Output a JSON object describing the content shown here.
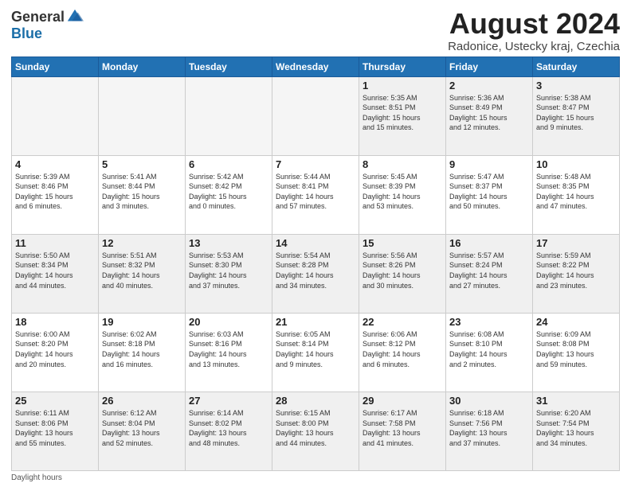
{
  "logo": {
    "general": "General",
    "blue": "Blue"
  },
  "title": "August 2024",
  "subtitle": "Radonice, Ustecky kraj, Czechia",
  "days_of_week": [
    "Sunday",
    "Monday",
    "Tuesday",
    "Wednesday",
    "Thursday",
    "Friday",
    "Saturday"
  ],
  "footer": "Daylight hours",
  "weeks": [
    [
      {
        "day": "",
        "info": ""
      },
      {
        "day": "",
        "info": ""
      },
      {
        "day": "",
        "info": ""
      },
      {
        "day": "",
        "info": ""
      },
      {
        "day": "1",
        "info": "Sunrise: 5:35 AM\nSunset: 8:51 PM\nDaylight: 15 hours\nand 15 minutes."
      },
      {
        "day": "2",
        "info": "Sunrise: 5:36 AM\nSunset: 8:49 PM\nDaylight: 15 hours\nand 12 minutes."
      },
      {
        "day": "3",
        "info": "Sunrise: 5:38 AM\nSunset: 8:47 PM\nDaylight: 15 hours\nand 9 minutes."
      }
    ],
    [
      {
        "day": "4",
        "info": "Sunrise: 5:39 AM\nSunset: 8:46 PM\nDaylight: 15 hours\nand 6 minutes."
      },
      {
        "day": "5",
        "info": "Sunrise: 5:41 AM\nSunset: 8:44 PM\nDaylight: 15 hours\nand 3 minutes."
      },
      {
        "day": "6",
        "info": "Sunrise: 5:42 AM\nSunset: 8:42 PM\nDaylight: 15 hours\nand 0 minutes."
      },
      {
        "day": "7",
        "info": "Sunrise: 5:44 AM\nSunset: 8:41 PM\nDaylight: 14 hours\nand 57 minutes."
      },
      {
        "day": "8",
        "info": "Sunrise: 5:45 AM\nSunset: 8:39 PM\nDaylight: 14 hours\nand 53 minutes."
      },
      {
        "day": "9",
        "info": "Sunrise: 5:47 AM\nSunset: 8:37 PM\nDaylight: 14 hours\nand 50 minutes."
      },
      {
        "day": "10",
        "info": "Sunrise: 5:48 AM\nSunset: 8:35 PM\nDaylight: 14 hours\nand 47 minutes."
      }
    ],
    [
      {
        "day": "11",
        "info": "Sunrise: 5:50 AM\nSunset: 8:34 PM\nDaylight: 14 hours\nand 44 minutes."
      },
      {
        "day": "12",
        "info": "Sunrise: 5:51 AM\nSunset: 8:32 PM\nDaylight: 14 hours\nand 40 minutes."
      },
      {
        "day": "13",
        "info": "Sunrise: 5:53 AM\nSunset: 8:30 PM\nDaylight: 14 hours\nand 37 minutes."
      },
      {
        "day": "14",
        "info": "Sunrise: 5:54 AM\nSunset: 8:28 PM\nDaylight: 14 hours\nand 34 minutes."
      },
      {
        "day": "15",
        "info": "Sunrise: 5:56 AM\nSunset: 8:26 PM\nDaylight: 14 hours\nand 30 minutes."
      },
      {
        "day": "16",
        "info": "Sunrise: 5:57 AM\nSunset: 8:24 PM\nDaylight: 14 hours\nand 27 minutes."
      },
      {
        "day": "17",
        "info": "Sunrise: 5:59 AM\nSunset: 8:22 PM\nDaylight: 14 hours\nand 23 minutes."
      }
    ],
    [
      {
        "day": "18",
        "info": "Sunrise: 6:00 AM\nSunset: 8:20 PM\nDaylight: 14 hours\nand 20 minutes."
      },
      {
        "day": "19",
        "info": "Sunrise: 6:02 AM\nSunset: 8:18 PM\nDaylight: 14 hours\nand 16 minutes."
      },
      {
        "day": "20",
        "info": "Sunrise: 6:03 AM\nSunset: 8:16 PM\nDaylight: 14 hours\nand 13 minutes."
      },
      {
        "day": "21",
        "info": "Sunrise: 6:05 AM\nSunset: 8:14 PM\nDaylight: 14 hours\nand 9 minutes."
      },
      {
        "day": "22",
        "info": "Sunrise: 6:06 AM\nSunset: 8:12 PM\nDaylight: 14 hours\nand 6 minutes."
      },
      {
        "day": "23",
        "info": "Sunrise: 6:08 AM\nSunset: 8:10 PM\nDaylight: 14 hours\nand 2 minutes."
      },
      {
        "day": "24",
        "info": "Sunrise: 6:09 AM\nSunset: 8:08 PM\nDaylight: 13 hours\nand 59 minutes."
      }
    ],
    [
      {
        "day": "25",
        "info": "Sunrise: 6:11 AM\nSunset: 8:06 PM\nDaylight: 13 hours\nand 55 minutes."
      },
      {
        "day": "26",
        "info": "Sunrise: 6:12 AM\nSunset: 8:04 PM\nDaylight: 13 hours\nand 52 minutes."
      },
      {
        "day": "27",
        "info": "Sunrise: 6:14 AM\nSunset: 8:02 PM\nDaylight: 13 hours\nand 48 minutes."
      },
      {
        "day": "28",
        "info": "Sunrise: 6:15 AM\nSunset: 8:00 PM\nDaylight: 13 hours\nand 44 minutes."
      },
      {
        "day": "29",
        "info": "Sunrise: 6:17 AM\nSunset: 7:58 PM\nDaylight: 13 hours\nand 41 minutes."
      },
      {
        "day": "30",
        "info": "Sunrise: 6:18 AM\nSunset: 7:56 PM\nDaylight: 13 hours\nand 37 minutes."
      },
      {
        "day": "31",
        "info": "Sunrise: 6:20 AM\nSunset: 7:54 PM\nDaylight: 13 hours\nand 34 minutes."
      }
    ]
  ]
}
